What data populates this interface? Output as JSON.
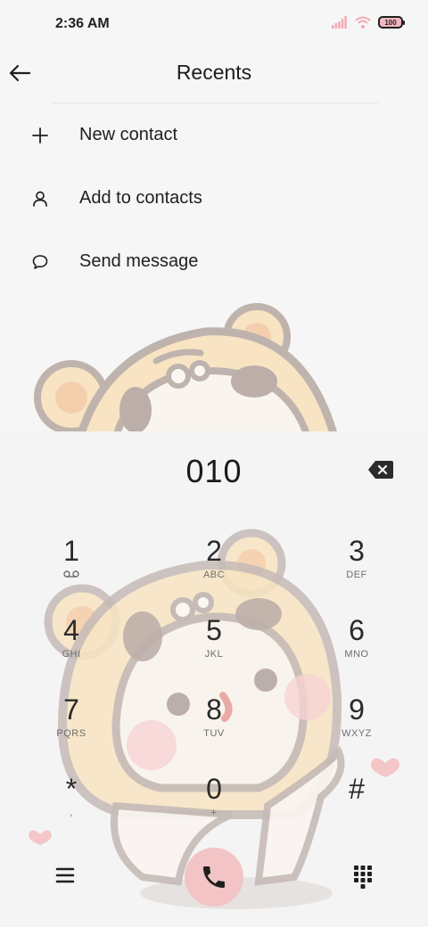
{
  "status_bar": {
    "time": "2:36 AM",
    "battery_level": "100",
    "icons": [
      "signal-icon",
      "wifi-icon",
      "battery-icon"
    ]
  },
  "header": {
    "title": "Recents",
    "back_icon": "arrow-left-icon"
  },
  "menu": {
    "items": [
      {
        "label": "New contact",
        "icon": "plus-icon"
      },
      {
        "label": "Add to contacts",
        "icon": "person-icon"
      },
      {
        "label": "Send message",
        "icon": "chat-bubble-icon"
      }
    ]
  },
  "dialer": {
    "number": "010",
    "backspace_icon": "backspace-icon",
    "keys": [
      {
        "digit": "1",
        "letters": "",
        "sub_icon": "voicemail-icon"
      },
      {
        "digit": "2",
        "letters": "ABC"
      },
      {
        "digit": "3",
        "letters": "DEF"
      },
      {
        "digit": "4",
        "letters": "GHI"
      },
      {
        "digit": "5",
        "letters": "JKL"
      },
      {
        "digit": "6",
        "letters": "MNO"
      },
      {
        "digit": "7",
        "letters": "PQRS"
      },
      {
        "digit": "8",
        "letters": "TUV"
      },
      {
        "digit": "9",
        "letters": "WXYZ"
      },
      {
        "digit": "*",
        "letters": ","
      },
      {
        "digit": "0",
        "letters": "+"
      },
      {
        "digit": "#",
        "letters": ""
      }
    ],
    "bottom_bar": {
      "menu_icon": "menu-lines-icon",
      "call_icon": "phone-icon",
      "keypad_icon": "keypad-grid-icon"
    }
  },
  "colors": {
    "background": "#f6f6f6",
    "call_button": "#f2c4c6",
    "battery_fill": "#f3b5c0",
    "signal_wifi": "#f1a9b4"
  }
}
